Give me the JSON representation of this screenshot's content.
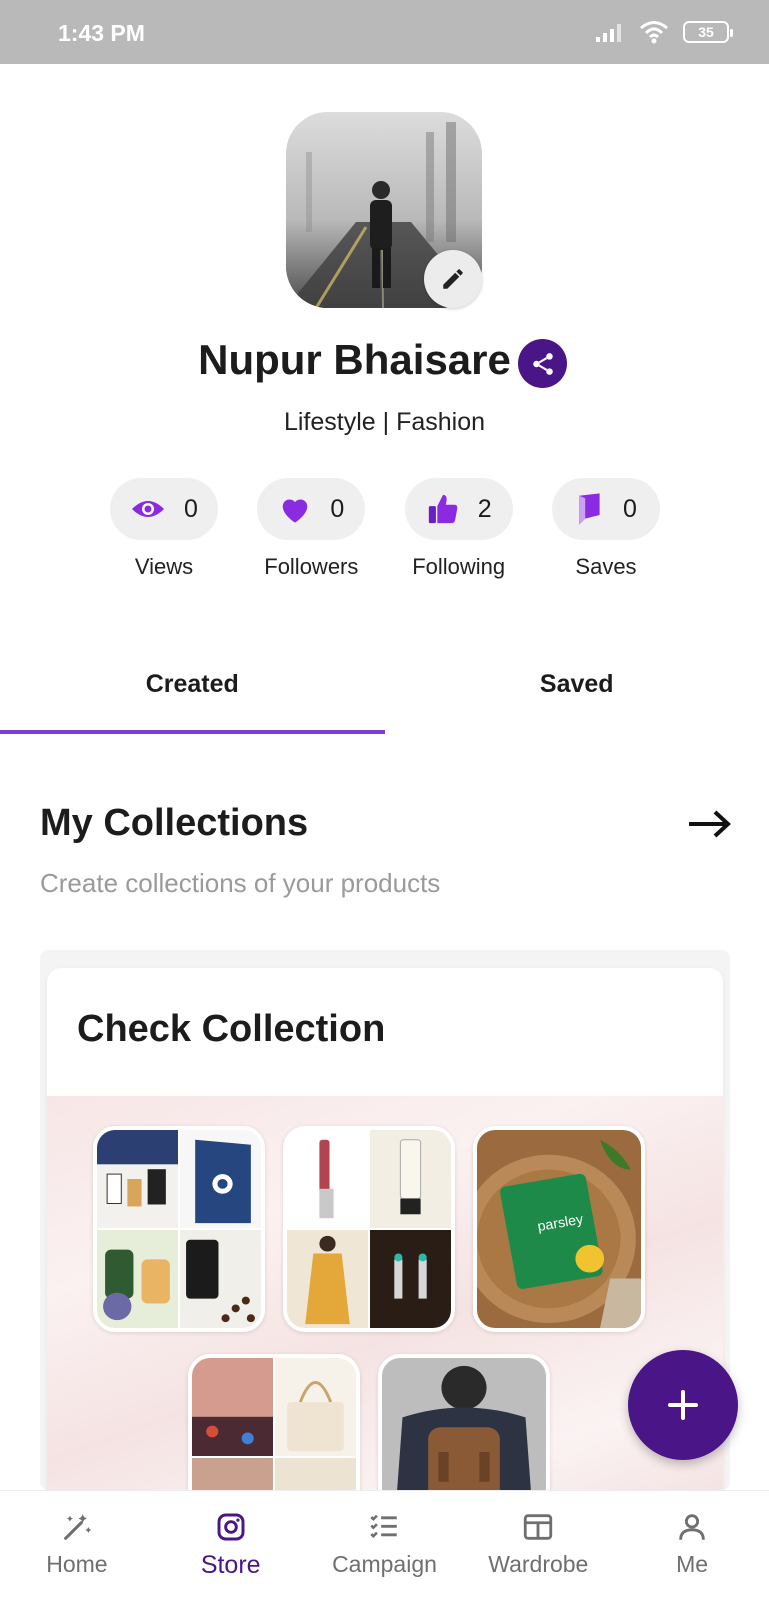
{
  "status_bar": {
    "time": "1:43 PM",
    "battery": "35"
  },
  "profile": {
    "name": "Nupur Bhaisare",
    "tagline": "Lifestyle | Fashion"
  },
  "stats": [
    {
      "icon": "eye-icon",
      "count": "0",
      "label": "Views"
    },
    {
      "icon": "heart-icon",
      "count": "0",
      "label": "Followers"
    },
    {
      "icon": "thumbs-up-icon",
      "count": "2",
      "label": "Following"
    },
    {
      "icon": "bookmark-flag-icon",
      "count": "0",
      "label": "Saves"
    }
  ],
  "tabs": [
    {
      "label": "Created",
      "active": true
    },
    {
      "label": "Saved",
      "active": false
    }
  ],
  "collections": {
    "title": "My Collections",
    "subtitle": "Create collections of your products",
    "card_title": "Check Collection"
  },
  "bottom_nav": [
    {
      "label": "Home",
      "icon": "magic-wand-icon",
      "active": false
    },
    {
      "label": "Store",
      "icon": "instagram-icon",
      "active": true
    },
    {
      "label": "Campaign",
      "icon": "checklist-icon",
      "active": false
    },
    {
      "label": "Wardrobe",
      "icon": "wardrobe-icon",
      "active": false
    },
    {
      "label": "Me",
      "icon": "user-icon",
      "active": false
    }
  ],
  "colors": {
    "primary": "#4a1587",
    "accent": "#7b3fd4",
    "icon_purple": "#8a2be2"
  }
}
